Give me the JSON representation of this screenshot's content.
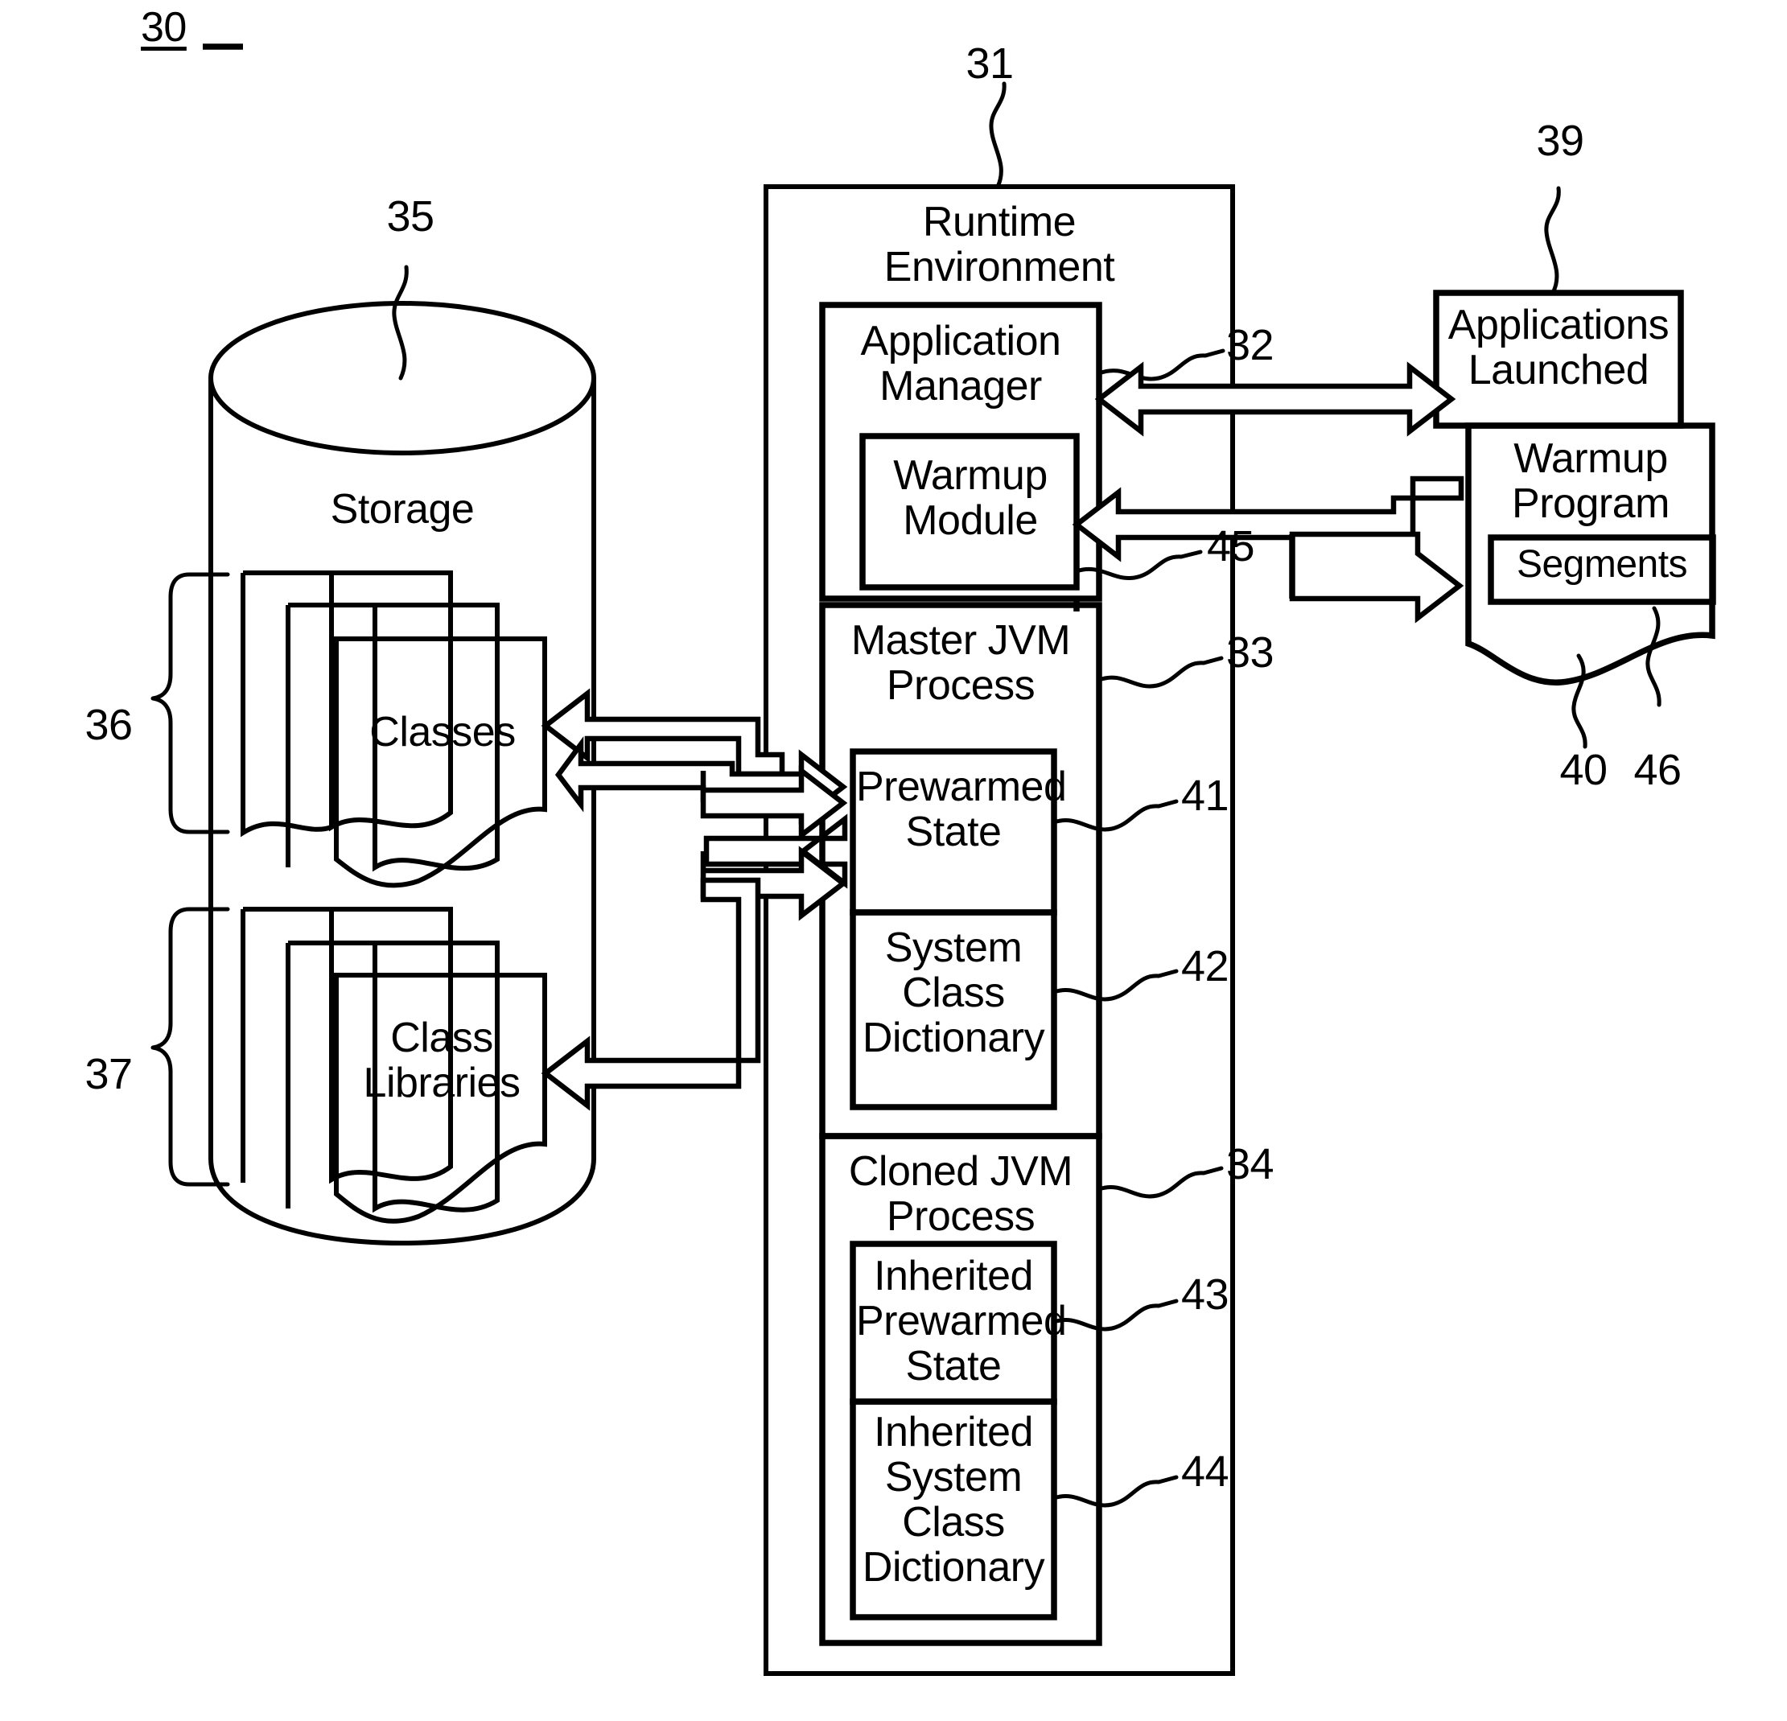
{
  "figure": {
    "title": "30"
  },
  "storage": {
    "label": "Storage",
    "ref": "35",
    "classes_label": "Classes",
    "classes_ref": "36",
    "class_libraries_label": "Class\nLibraries",
    "class_libraries_ref": "37"
  },
  "runtime": {
    "label": "Runtime\nEnvironment",
    "ref": "31",
    "application_manager": {
      "label": "Application\nManager",
      "ref": "32",
      "warmup_module": {
        "label": "Warmup\nModule",
        "ref": "45"
      }
    },
    "master_jvm": {
      "label": "Master JVM\nProcess",
      "ref": "33",
      "prewarmed_state": {
        "label": "Prewarmed\nState",
        "ref": "41"
      },
      "system_class_dictionary": {
        "label": "System\nClass\nDictionary",
        "ref": "42"
      }
    },
    "cloned_jvm": {
      "label": "Cloned JVM\nProcess",
      "ref": "34",
      "inherited_prewarmed_state": {
        "label": "Inherited\nPrewarmed\nState",
        "ref": "43"
      },
      "inherited_system_class_dictionary": {
        "label": "Inherited\nSystem\nClass\nDictionary",
        "ref": "44"
      }
    }
  },
  "applications": {
    "label": "Applications\nLaunched",
    "ref": "39",
    "warmup_program": {
      "label": "Warmup\nProgram",
      "ref": "40",
      "segments": {
        "label": "Segments",
        "ref": "46"
      }
    }
  },
  "colors": {
    "ink": "#000000",
    "paper": "#ffffff"
  }
}
